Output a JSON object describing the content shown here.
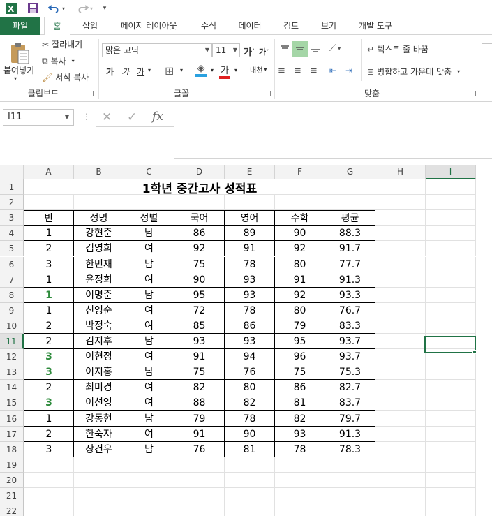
{
  "qat": {
    "excel_icon": "excel-logo-icon",
    "save_icon": "save-icon",
    "undo_icon": "undo-icon",
    "redo_icon": "redo-icon",
    "customize_icon": "customize-qat-icon"
  },
  "tabs": [
    {
      "label": "파일"
    },
    {
      "label": "홈"
    },
    {
      "label": "삽입"
    },
    {
      "label": "페이지 레이아웃"
    },
    {
      "label": "수식"
    },
    {
      "label": "데이터"
    },
    {
      "label": "검토"
    },
    {
      "label": "보기"
    },
    {
      "label": "개발 도구"
    }
  ],
  "ribbon": {
    "clipboard": {
      "paste_label": "붙여넣기",
      "cut_label": "잘라내기",
      "copy_label": "복사",
      "format_painter_label": "서식 복사",
      "group_label": "클립보드"
    },
    "font": {
      "font_name": "맑은 고딕",
      "font_size": "11",
      "grow_label": "가",
      "shrink_label": "가",
      "bold_label": "가",
      "italic_label": "가",
      "underline_label": "가",
      "font_color_label": "가",
      "phonetic_label": "내천",
      "group_label": "글꼴"
    },
    "alignment": {
      "wrap_text_label": "텍스트 줄 바꿈",
      "merge_center_label": "병합하고 가운데 맞춤",
      "group_label": "맞춤"
    }
  },
  "formula_bar": {
    "name_box": "I11",
    "fx_label": "fx",
    "formula": ""
  },
  "sheet": {
    "columns": [
      "A",
      "B",
      "C",
      "D",
      "E",
      "F",
      "G",
      "H",
      "I"
    ],
    "selected_column": "I",
    "selected_row": "11",
    "row_numbers": [
      "1",
      "2",
      "3",
      "4",
      "5",
      "6",
      "7",
      "8",
      "9",
      "10",
      "11",
      "12",
      "13",
      "14",
      "15",
      "16",
      "17",
      "18",
      "19",
      "20",
      "21",
      "22"
    ],
    "title": "1학년 중간고사 성적표",
    "headers": [
      "반",
      "성명",
      "성별",
      "국어",
      "영어",
      "수학",
      "평균"
    ],
    "rows": [
      {
        "ban": "1",
        "name": "강현준",
        "gender": "남",
        "kor": "86",
        "eng": "89",
        "math": "90",
        "avg": "88.3",
        "flag": false
      },
      {
        "ban": "2",
        "name": "김영희",
        "gender": "여",
        "kor": "92",
        "eng": "91",
        "math": "92",
        "avg": "91.7",
        "flag": false
      },
      {
        "ban": "3",
        "name": "한민재",
        "gender": "남",
        "kor": "75",
        "eng": "78",
        "math": "80",
        "avg": "77.7",
        "flag": false
      },
      {
        "ban": "1",
        "name": "윤정희",
        "gender": "여",
        "kor": "90",
        "eng": "93",
        "math": "91",
        "avg": "91.3",
        "flag": false
      },
      {
        "ban": "1",
        "name": "이명준",
        "gender": "남",
        "kor": "95",
        "eng": "93",
        "math": "92",
        "avg": "93.3",
        "flag": true
      },
      {
        "ban": "1",
        "name": "신영순",
        "gender": "여",
        "kor": "72",
        "eng": "78",
        "math": "80",
        "avg": "76.7",
        "flag": false
      },
      {
        "ban": "2",
        "name": "박정숙",
        "gender": "여",
        "kor": "85",
        "eng": "86",
        "math": "79",
        "avg": "83.3",
        "flag": false
      },
      {
        "ban": "2",
        "name": "김지후",
        "gender": "남",
        "kor": "93",
        "eng": "93",
        "math": "95",
        "avg": "93.7",
        "flag": false
      },
      {
        "ban": "3",
        "name": "이현정",
        "gender": "여",
        "kor": "91",
        "eng": "94",
        "math": "96",
        "avg": "93.7",
        "flag": true
      },
      {
        "ban": "3",
        "name": "이지홍",
        "gender": "남",
        "kor": "75",
        "eng": "76",
        "math": "75",
        "avg": "75.3",
        "flag": true
      },
      {
        "ban": "2",
        "name": "최미경",
        "gender": "여",
        "kor": "82",
        "eng": "80",
        "math": "86",
        "avg": "82.7",
        "flag": false
      },
      {
        "ban": "3",
        "name": "이선영",
        "gender": "여",
        "kor": "88",
        "eng": "82",
        "math": "81",
        "avg": "83.7",
        "flag": true
      },
      {
        "ban": "1",
        "name": "강동현",
        "gender": "남",
        "kor": "79",
        "eng": "78",
        "math": "82",
        "avg": "79.7",
        "flag": false
      },
      {
        "ban": "2",
        "name": "한숙자",
        "gender": "여",
        "kor": "91",
        "eng": "90",
        "math": "93",
        "avg": "91.3",
        "flag": false
      },
      {
        "ban": "3",
        "name": "장건우",
        "gender": "남",
        "kor": "76",
        "eng": "81",
        "math": "78",
        "avg": "78.3",
        "flag": false
      }
    ]
  },
  "colors": {
    "accent": "#217346",
    "flag_text": "#2e8b3c"
  }
}
